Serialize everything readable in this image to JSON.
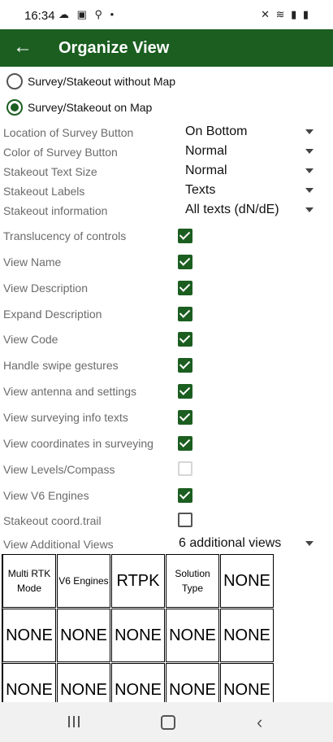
{
  "status": {
    "time": "16:34",
    "left_icons": "☁ ▣ ⚲ •",
    "right_icons": "✕ ≋ ▮ ▮"
  },
  "appbar": {
    "title": "Organize View"
  },
  "view_mode": {
    "options": [
      {
        "label": "Survey/Stakeout without Map",
        "selected": false
      },
      {
        "label": "Survey/Stakeout on Map",
        "selected": true
      }
    ]
  },
  "settings": {
    "location_of_survey_button": {
      "label": "Location of Survey Button",
      "value": "On Bottom"
    },
    "color_of_survey_button": {
      "label": "Color of Survey Button",
      "value": "Normal"
    },
    "stakeout_text_size": {
      "label": "Stakeout Text Size",
      "value": "Normal"
    },
    "stakeout_labels": {
      "label": "Stakeout Labels",
      "value": "Texts"
    },
    "stakeout_information": {
      "label": "Stakeout information",
      "value": "All texts (dN/dE)"
    }
  },
  "checkboxes": [
    {
      "label": "Translucency of controls",
      "state": "checked"
    },
    {
      "label": "View Name",
      "state": "checked"
    },
    {
      "label": "View Description",
      "state": "checked"
    },
    {
      "label": "Expand Description",
      "state": "checked"
    },
    {
      "label": "View Code",
      "state": "checked"
    },
    {
      "label": "Handle swipe gestures",
      "state": "checked"
    },
    {
      "label": "View antenna and settings",
      "state": "checked"
    },
    {
      "label": "View surveying info texts",
      "state": "checked"
    },
    {
      "label": "View coordinates in surveying",
      "state": "checked"
    },
    {
      "label": "View Levels/Compass",
      "state": "disabled-unchecked"
    },
    {
      "label": "View V6 Engines",
      "state": "checked"
    },
    {
      "label": "Stakeout coord.trail",
      "state": "unchecked"
    }
  ],
  "additional_views": {
    "label": "View Additional Views",
    "value": "6 additional views"
  },
  "views_grid": {
    "row1": [
      "Multi RTK Mode",
      "V6 Engines",
      "RTPK",
      "Solution Type",
      "NONE"
    ],
    "row2": [
      "NONE",
      "NONE",
      "NONE",
      "NONE",
      "NONE"
    ],
    "row3": [
      "NONE",
      "NONE",
      "NONE",
      "NONE",
      "NONE"
    ]
  },
  "colors": {
    "primary": "#1b5e20",
    "label_gray": "#6b6b6b"
  }
}
